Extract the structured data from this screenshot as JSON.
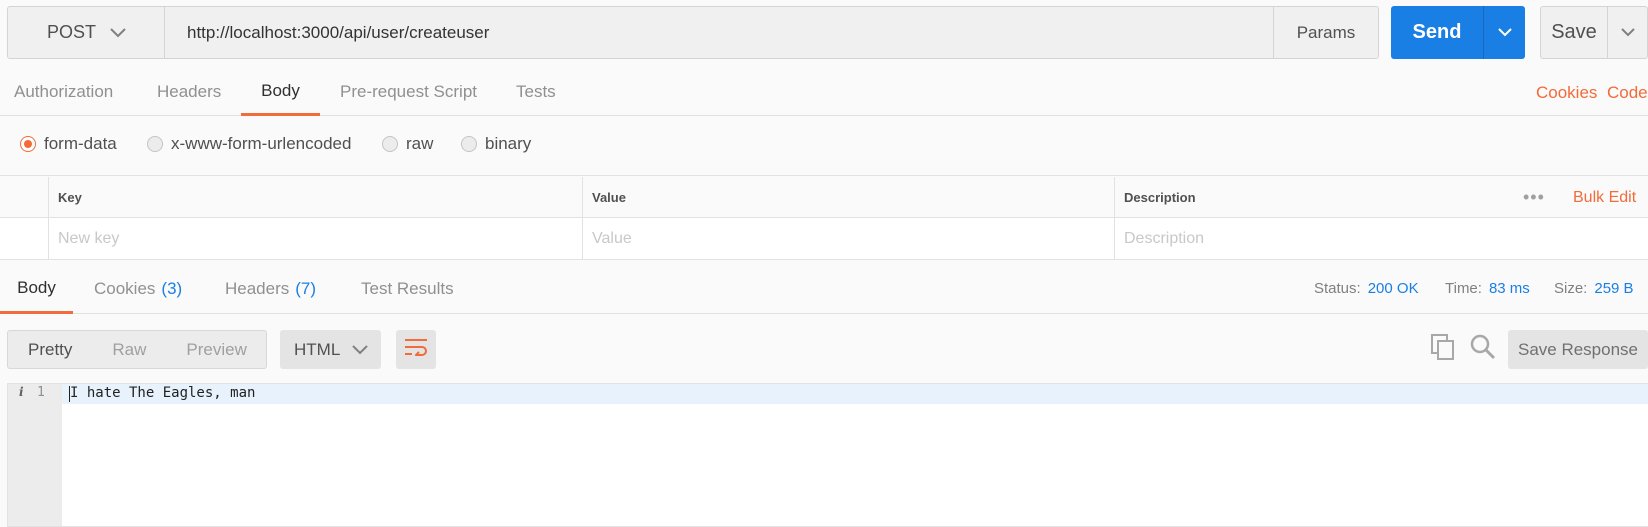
{
  "request": {
    "method": "POST",
    "url": "http://localhost:3000/api/user/createuser",
    "params_label": "Params",
    "send_label": "Send",
    "save_label": "Save"
  },
  "request_tabs": [
    "Authorization",
    "Headers",
    "Body",
    "Pre-request Script",
    "Tests"
  ],
  "request_tabs_active": "Body",
  "request_links": {
    "cookies": "Cookies",
    "code": "Code"
  },
  "body_types": [
    "form-data",
    "x-www-form-urlencoded",
    "raw",
    "binary"
  ],
  "body_type_selected": "form-data",
  "kv_table": {
    "headers": {
      "key": "Key",
      "value": "Value",
      "description": "Description"
    },
    "placeholders": {
      "key": "New key",
      "value": "Value",
      "description": "Description"
    },
    "more_glyph": "•••",
    "bulk_edit": "Bulk Edit"
  },
  "response_tabs": {
    "body": "Body",
    "cookies": "Cookies",
    "cookies_count": "(3)",
    "headers": "Headers",
    "headers_count": "(7)",
    "test_results": "Test Results",
    "active": "Body"
  },
  "response_meta": {
    "status_label": "Status:",
    "status_value": "200 OK",
    "time_label": "Time:",
    "time_value": "83 ms",
    "size_label": "Size:",
    "size_value": "259 B"
  },
  "response_toolbar": {
    "views": [
      "Pretty",
      "Raw",
      "Preview"
    ],
    "view_active": "Pretty",
    "format": "HTML",
    "save_response": "Save Response"
  },
  "editor": {
    "lines": [
      {
        "number": "1",
        "text": "I hate The Eagles, man"
      }
    ]
  },
  "colors": {
    "accent": "#f26b3a",
    "primary": "#1a7fe5"
  },
  "icons": [
    "chevron-down-icon",
    "wrap-lines-icon",
    "copy-icon",
    "search-icon",
    "info-icon"
  ]
}
